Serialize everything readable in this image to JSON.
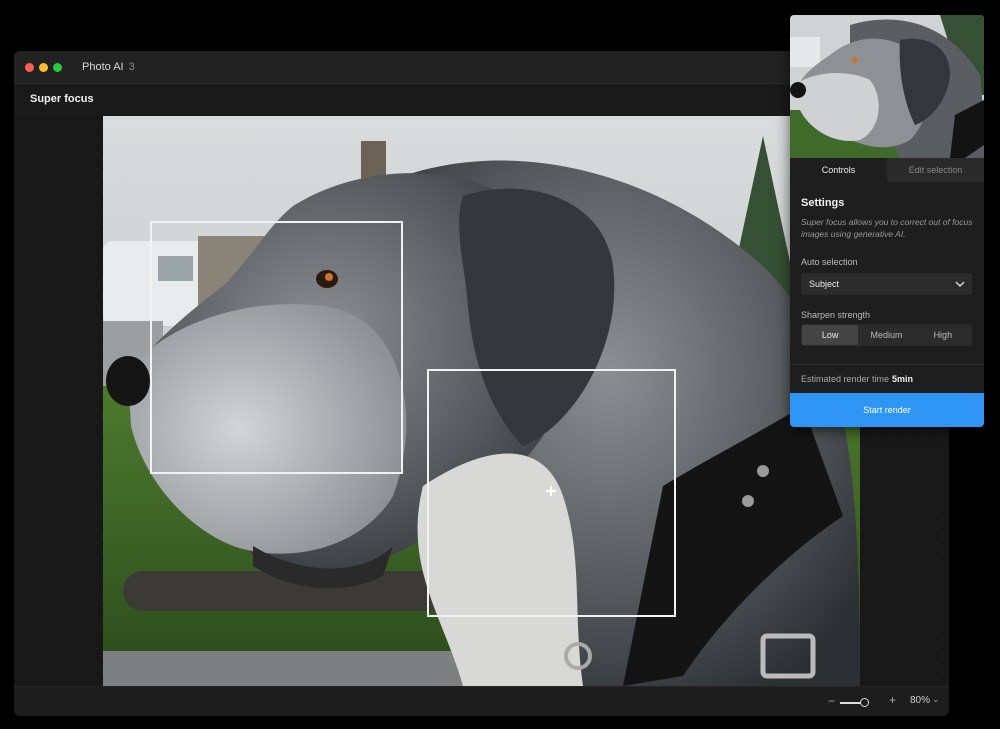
{
  "window": {
    "app_name": "Photo AI",
    "app_version": "3",
    "traffic_lights": {
      "close": "#ff5f57",
      "minimize": "#febc2e",
      "zoom": "#28c840"
    }
  },
  "header": {
    "mode_title": "Super focus"
  },
  "canvas": {
    "image_subject": "dog",
    "selections": [
      "face-selection-box",
      "neck-selection-box"
    ]
  },
  "zoom": {
    "minus": "−",
    "plus": "+",
    "level": "80%",
    "chevron": "⌄"
  },
  "panel": {
    "tabs": [
      {
        "label": "Controls",
        "active": true
      },
      {
        "label": "Edit selection",
        "active": false
      }
    ],
    "settings_title": "Settings",
    "settings_desc": "Super focus allows you to correct out of focus images using generative AI.",
    "auto_selection_label": "Auto selection",
    "auto_selection_value": "Subject",
    "sharpen_label": "Sharpen strength",
    "sharpen_options": [
      "Low",
      "Medium",
      "High"
    ],
    "sharpen_selected": "Low",
    "est_label": "Estimated render time",
    "est_value": "5min",
    "render_button": "Start render",
    "accent_color": "#2f95f5"
  }
}
